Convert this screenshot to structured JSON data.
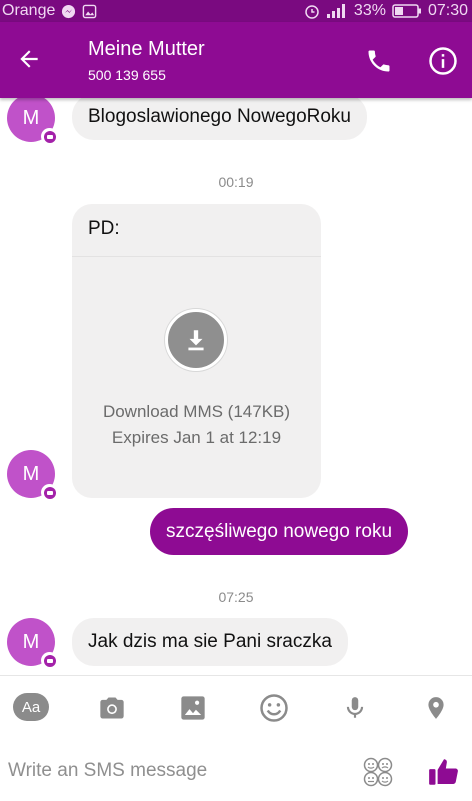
{
  "status_bar": {
    "carrier": "Orange",
    "battery_percent": "33%",
    "time": "07:30"
  },
  "header": {
    "contact_name": "Meine Mutter",
    "phone_number": "500 139 655"
  },
  "messages": {
    "msg1": {
      "avatar_initial": "M",
      "text": "Blogoslawionego NowegoRoku"
    },
    "time1": "00:19",
    "mms": {
      "avatar_initial": "M",
      "title": "PD:",
      "download_label": "Download MMS (147KB)",
      "expires_label": "Expires Jan 1 at 12:19"
    },
    "sent1": {
      "text": "szczęśliwego nowego roku"
    },
    "time2": "07:25",
    "msg2": {
      "avatar_initial": "M",
      "text": "Jak dzis ma sie Pani sraczka"
    }
  },
  "composer": {
    "aa_label": "Aa",
    "placeholder": "Write an SMS message"
  },
  "colors": {
    "primary": "#8e0b93",
    "status_bar": "#7a0a80",
    "avatar": "#c052c9",
    "bubble_in": "#f1f0f0"
  },
  "icons": {
    "back": "arrow-left-icon",
    "call": "phone-icon",
    "info": "info-icon",
    "camera": "camera-icon",
    "gallery": "image-icon",
    "emoji": "smiley-icon",
    "mic": "microphone-icon",
    "location": "location-pin-icon",
    "stickers": "stickers-icon",
    "like": "thumbs-up-icon",
    "download": "download-icon"
  }
}
